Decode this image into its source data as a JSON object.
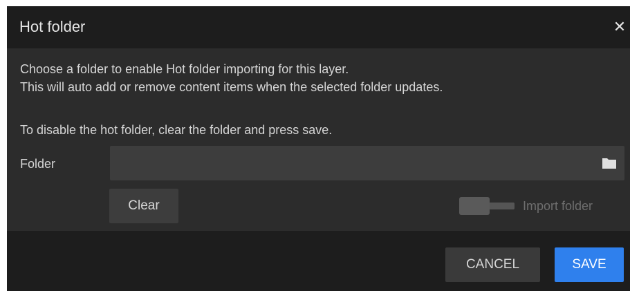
{
  "dialog": {
    "title": "Hot folder",
    "close_glyph": "✕",
    "description_line1": "Choose a folder to enable Hot folder importing for this layer.",
    "description_line2": "This will auto add or remove content items when the selected folder updates.",
    "description_line3": "To disable the hot folder, clear the folder and press save.",
    "folder": {
      "label": "Folder",
      "value": "",
      "placeholder": "",
      "icon": "folder-icon"
    },
    "clear_label": "Clear",
    "import_toggle": {
      "label": "Import folder",
      "enabled": false
    },
    "footer": {
      "cancel_label": "CANCEL",
      "save_label": "SAVE"
    }
  },
  "colors": {
    "accent": "#2f80ed",
    "titlebar": "#1d1d1d",
    "body": "#2c2c2c",
    "field": "#3d3d3d"
  }
}
